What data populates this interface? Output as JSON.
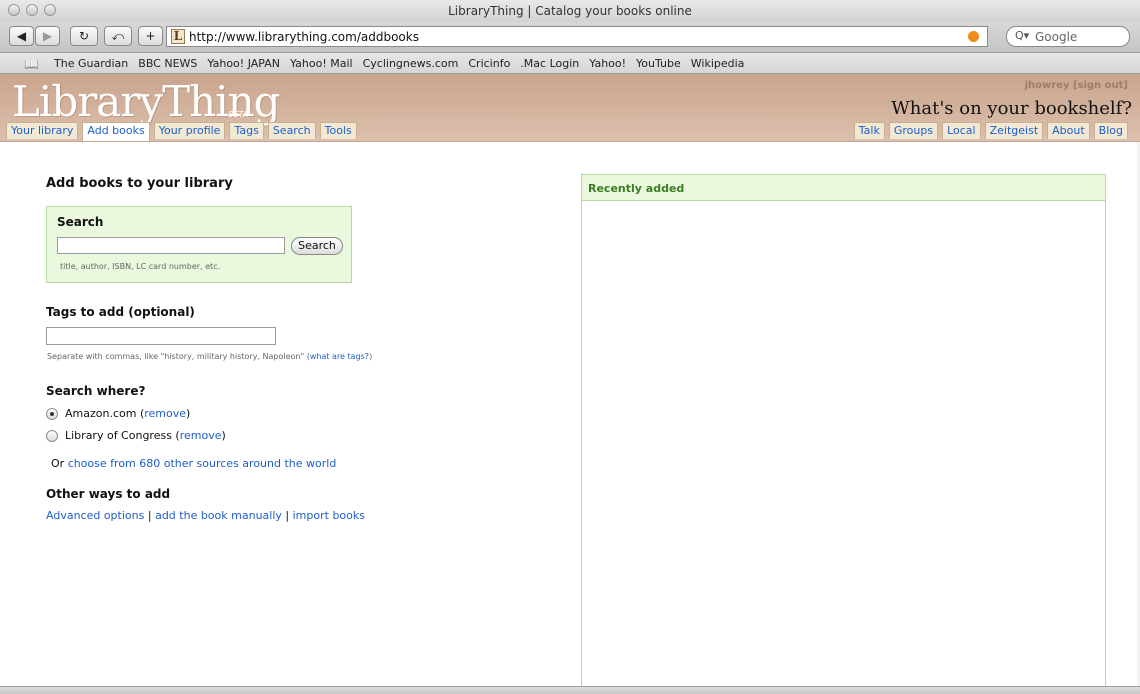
{
  "window": {
    "title": "LibraryThing | Catalog your books online"
  },
  "toolbar": {
    "back_icon": "back-arrow-icon",
    "forward_icon": "forward-arrow-icon",
    "reload_icon": "reload-icon",
    "snapback_icon": "snapback-icon",
    "add_bookmark_icon": "plus-icon",
    "url": "http://www.librarything.com/addbooks",
    "search_placeholder": "Google"
  },
  "bookmarks": [
    "The Guardian",
    "BBC NEWS",
    "Yahoo! JAPAN",
    "Yahoo! Mail",
    "Cyclingnews.com",
    "Cricinfo",
    ".Mac Login",
    "Yahoo!",
    "YouTube",
    "Wikipedia"
  ],
  "site": {
    "logo": "LibraryThing",
    "beta": "BETA",
    "user_link": "jhowrey [sign out]",
    "tagline": "What's on your bookshelf?",
    "tabs_left": [
      "Your library",
      "Add books",
      "Your profile",
      "Tags",
      "Search",
      "Tools"
    ],
    "active_tab": "Add books",
    "tabs_right": [
      "Talk",
      "Groups",
      "Local",
      "Zeitgeist",
      "About",
      "Blog"
    ]
  },
  "main": {
    "heading": "Add books to your library",
    "search": {
      "label": "Search",
      "value": "",
      "button": "Search",
      "hint": "title, author, ISBN, LC card number, etc."
    },
    "tags": {
      "heading": "Tags to add (optional)",
      "value": "",
      "hint_prefix": "Separate with commas, like \"history, military history, Napoleon\" (",
      "hint_link": "what are tags?",
      "hint_suffix": ")"
    },
    "where": {
      "heading": "Search where?",
      "options": [
        {
          "label": "Amazon.com",
          "remove": "remove",
          "selected": true
        },
        {
          "label": "Library of Congress",
          "remove": "remove",
          "selected": false
        }
      ],
      "or_prefix": "Or ",
      "or_link": "choose from 680 other sources around the world"
    },
    "other": {
      "heading": "Other ways to add",
      "links": [
        "Advanced options",
        "add the book manually",
        "import books"
      ],
      "separator": "|"
    }
  },
  "recent": {
    "title": "Recently added"
  },
  "colors": {
    "link": "#1f5ec9",
    "panel_bg": "#eaf8dd",
    "panel_border": "#b9d9a3",
    "recent_title": "#3a7d22",
    "header_bg": "#c9a48d"
  }
}
